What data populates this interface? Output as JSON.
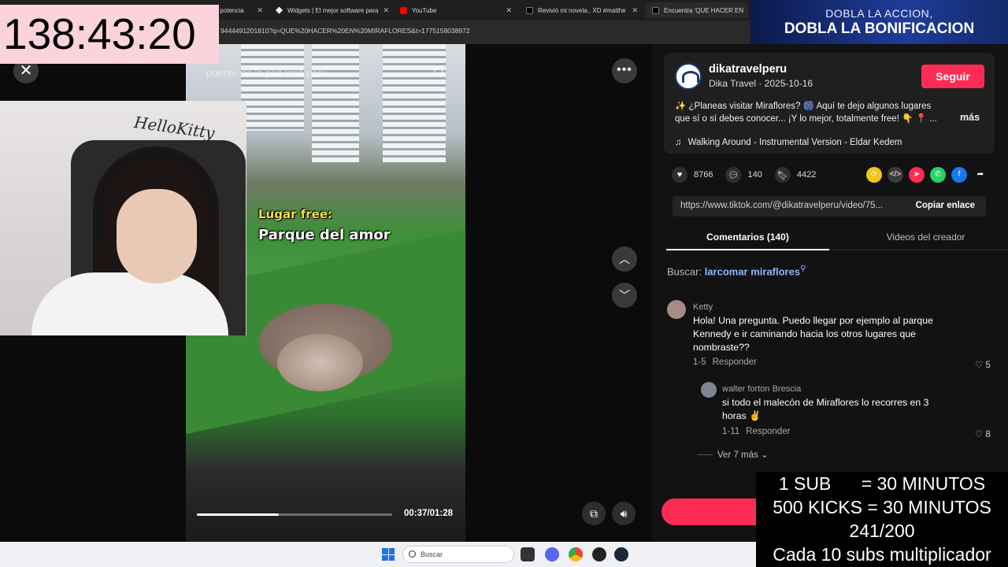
{
  "browser": {
    "tabs": [
      {
        "label": "ra potencia",
        "color": "#4a4a4a"
      },
      {
        "label": "Widgets | El mejor software para",
        "color": "#ffffff"
      },
      {
        "label": "YouTube",
        "color": "#ff0000"
      },
      {
        "label": "Revivió mi novela.. XD #matthe",
        "color": "#000000"
      },
      {
        "label": "Encuentra 'QUE HACER EN",
        "color": "#000000"
      }
    ],
    "url": "9444491201810?q=QUE%20HACER%20EN%20MIRAFLORES&t=1775158038972"
  },
  "timer": "138:43:20",
  "promo": {
    "line1": "DOBLA LA ACCION,",
    "line2": "DOBLA LA BONIFICACION"
  },
  "video": {
    "search_text": "puente de la paz lima peru",
    "caption_line1": "Lugar free:",
    "caption_line2": "Parque del amor",
    "time": "00:37/01:28",
    "progress": 0.42,
    "webcam_text": "HelloKitty"
  },
  "controls": {
    "close": "✕",
    "more": "•••",
    "prev": "︿",
    "next": "﹀"
  },
  "post": {
    "username": "dikatravelperu",
    "subtitle": "Dika Travel · 2025-10-16",
    "follow_label": "Seguir",
    "description": "✨ ¿Planeas visitar Miraflores? 🎆 Aquí te dejo algunos lugares que sí o sí debes conocer... ¡Y lo mejor, totalmente free! 👇 📍 ...",
    "more_label": "más",
    "music": "Walking Around - Instrumental Version - Eldar Kedem",
    "likes": "8766",
    "comments": "140",
    "saves": "4422",
    "link": "https://www.tiktok.com/@dikatravelperu/video/75...",
    "copy_label": "Copiar enlace"
  },
  "share_colors": [
    "#f5c518",
    "#3a3a3a",
    "#fe2c55",
    "#25d366",
    "#1877f2",
    "#121212"
  ],
  "tabs": {
    "comments": "Comentarios (140)",
    "creator_videos": "Videos del creador"
  },
  "search_suggest": {
    "prefix": "Buscar: ",
    "keyword": "larcomar miraflores"
  },
  "comments": [
    {
      "name": "Ketty",
      "text": "Hola! Una pregunta. Puedo llegar por ejemplo al parque Kennedy e ir caminando hacia los otros lugares que nombraste??",
      "date": "1-5",
      "reply": "Responder",
      "likes": "5"
    },
    {
      "name": "walter forton Brescia",
      "text": "si todo el malecón de Miraflores lo recorres en 3 horas ✌️",
      "date": "1-11",
      "reply": "Responder",
      "likes": "8"
    }
  ],
  "view_more": "Ver 7 más",
  "subs_overlay": {
    "line1": "1 SUB      = 30 MINUTOS",
    "line2": "500 KICKS = 30 MINUTOS",
    "line3": "241/200",
    "line4": "Cada 10 subs multiplicador"
  },
  "taskbar": {
    "search_placeholder": "Buscar"
  }
}
